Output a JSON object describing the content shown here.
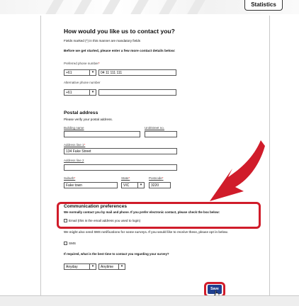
{
  "header": {
    "statistics_tab": "Statistics"
  },
  "form": {
    "title": "How would you like us to contact you?",
    "mandatory_note": "Fields marked (*) in this manner are mandatory fields",
    "intro": "Before we get started, please enter a few more contact details below:",
    "preferred_phone": {
      "label": "Preferred phone number",
      "req": "*",
      "country_code": "+61",
      "number": "04 11 111 111"
    },
    "alternative_phone": {
      "label": "Alternative phone number",
      "country_code": "+61",
      "number": ""
    },
    "postal": {
      "title": "Postal address",
      "subtitle": "Please verify your postal address.",
      "building_label": "Building name",
      "unit_label": "Unit/street no.",
      "building_value": "",
      "unit_value": "",
      "address1_label": "Address line 1",
      "address1_req": "*",
      "address1_value": "134 Fake Street",
      "address2_label": "Address line 2",
      "address2_value": "",
      "suburb_label": "Suburb",
      "suburb_req": "*",
      "suburb_value": "Fake town",
      "state_label": "State",
      "state_req": "*",
      "state_value": "VIC",
      "postcode_label": "Postcode",
      "postcode_req": "*",
      "postcode_value": "3220"
    },
    "comms": {
      "title": "Communication preferences",
      "description": "We normally contact you by mail and phone. If you prefer electronic contact, please check the box below:",
      "email_option": "Email (this is the email address you used to login)",
      "sms_note": "We might also send SMS notifications for some surveys. If you would like to receive these, please opt in below.",
      "sms_option": "SMS"
    },
    "best_time": {
      "question": "If required, what is the best time to contact you regarding your survey?",
      "day_value": "Anyday",
      "time_value": "Anytime"
    },
    "save_label": "Save"
  },
  "colors": {
    "highlight": "#d01c2a",
    "button": "#1f3f8f"
  },
  "icons": {
    "dropdown": "chevron-down-icon",
    "cursor": "hand-cursor-icon",
    "callout": "curved-arrow-icon"
  }
}
